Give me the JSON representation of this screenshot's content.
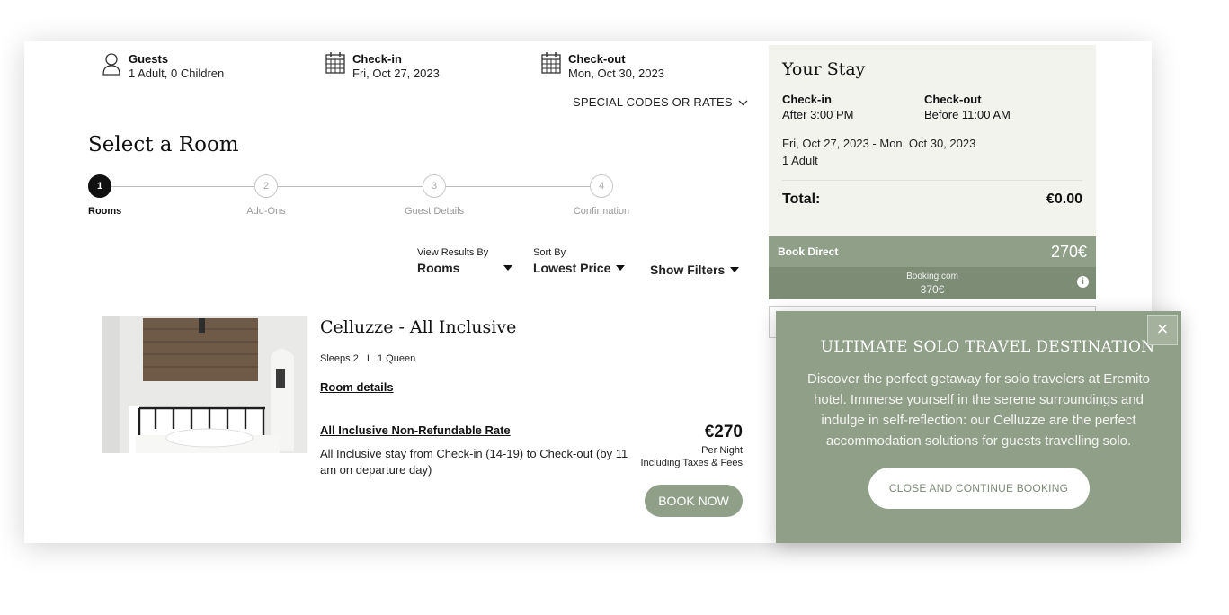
{
  "header": {
    "guests": {
      "label": "Guests",
      "value": "1 Adult, 0 Children",
      "icon": "person-icon"
    },
    "checkin": {
      "label": "Check-in",
      "value": "Fri, Oct 27, 2023",
      "icon": "calendar-icon"
    },
    "checkout": {
      "label": "Check-out",
      "value": "Mon, Oct 30, 2023",
      "icon": "calendar-icon"
    },
    "special_codes": "SPECIAL CODES OR RATES"
  },
  "main": {
    "title": "Select a Room",
    "steps": [
      {
        "number": "1",
        "label": "Rooms",
        "active": true
      },
      {
        "number": "2",
        "label": "Add-Ons",
        "active": false
      },
      {
        "number": "3",
        "label": "Guest Details",
        "active": false
      },
      {
        "number": "4",
        "label": "Confirmation",
        "active": false
      }
    ],
    "view_results": {
      "label": "View Results By",
      "value": "Rooms"
    },
    "sort_by": {
      "label": "Sort By",
      "value": "Lowest Price"
    },
    "show_filters": "Show Filters"
  },
  "room": {
    "name": "Celluzze - All Inclusive",
    "sleeps": "Sleeps 2",
    "separator": "I",
    "bed": "1 Queen",
    "details_link": "Room details",
    "rate_name": "All Inclusive Non-Refundable Rate",
    "rate_desc": "All Inclusive stay from Check-in (14-19) to Check-out (by 11 am on departure day)",
    "price": "€270",
    "per_night": "Per Night",
    "taxes": "Including Taxes & Fees",
    "book_now": "BOOK NOW"
  },
  "stay": {
    "title": "Your Stay",
    "checkin_label": "Check-in",
    "checkin_value": "After 3:00 PM",
    "checkout_label": "Check-out",
    "checkout_value": "Before 11:00 AM",
    "date_range": "Fri, Oct 27, 2023 - Mon, Oct 30, 2023",
    "guests": "1 Adult",
    "total_label": "Total:",
    "total_value": "€0.00"
  },
  "compare": {
    "direct_label": "Book Direct",
    "direct_price": "270€",
    "bookingcom_label": "Booking.com",
    "bookingcom_price": "370€",
    "info_icon": "i"
  },
  "modal": {
    "title": "ULTIMATE SOLO TRAVEL DESTINATION",
    "body": "Discover the perfect getaway for solo travelers at Eremito hotel. Immerse yourself in the serene surroundings and indulge in self-reflection: our Celluzze are the perfect accommodation solutions for guests travelling solo.",
    "button": "CLOSE AND CONTINUE BOOKING",
    "close_symbol": "×"
  },
  "colors": {
    "accent": "#8f9f88",
    "accent_dark": "#7c8c75",
    "panel_bg": "#f3f3ee"
  }
}
